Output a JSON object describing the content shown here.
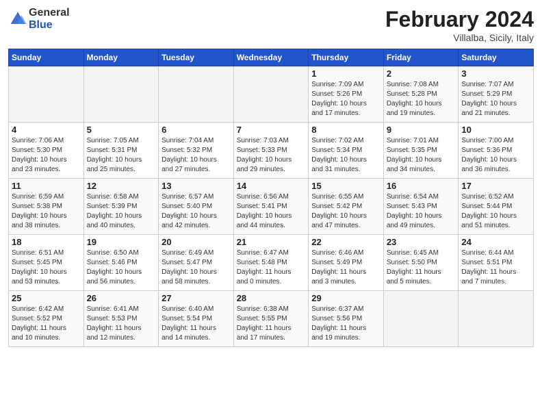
{
  "logo": {
    "general": "General",
    "blue": "Blue"
  },
  "header": {
    "month": "February 2024",
    "location": "Villalba, Sicily, Italy"
  },
  "days_of_week": [
    "Sunday",
    "Monday",
    "Tuesday",
    "Wednesday",
    "Thursday",
    "Friday",
    "Saturday"
  ],
  "weeks": [
    [
      {
        "day": "",
        "info": ""
      },
      {
        "day": "",
        "info": ""
      },
      {
        "day": "",
        "info": ""
      },
      {
        "day": "",
        "info": ""
      },
      {
        "day": "1",
        "info": "Sunrise: 7:09 AM\nSunset: 5:26 PM\nDaylight: 10 hours\nand 17 minutes."
      },
      {
        "day": "2",
        "info": "Sunrise: 7:08 AM\nSunset: 5:28 PM\nDaylight: 10 hours\nand 19 minutes."
      },
      {
        "day": "3",
        "info": "Sunrise: 7:07 AM\nSunset: 5:29 PM\nDaylight: 10 hours\nand 21 minutes."
      }
    ],
    [
      {
        "day": "4",
        "info": "Sunrise: 7:06 AM\nSunset: 5:30 PM\nDaylight: 10 hours\nand 23 minutes."
      },
      {
        "day": "5",
        "info": "Sunrise: 7:05 AM\nSunset: 5:31 PM\nDaylight: 10 hours\nand 25 minutes."
      },
      {
        "day": "6",
        "info": "Sunrise: 7:04 AM\nSunset: 5:32 PM\nDaylight: 10 hours\nand 27 minutes."
      },
      {
        "day": "7",
        "info": "Sunrise: 7:03 AM\nSunset: 5:33 PM\nDaylight: 10 hours\nand 29 minutes."
      },
      {
        "day": "8",
        "info": "Sunrise: 7:02 AM\nSunset: 5:34 PM\nDaylight: 10 hours\nand 31 minutes."
      },
      {
        "day": "9",
        "info": "Sunrise: 7:01 AM\nSunset: 5:35 PM\nDaylight: 10 hours\nand 34 minutes."
      },
      {
        "day": "10",
        "info": "Sunrise: 7:00 AM\nSunset: 5:36 PM\nDaylight: 10 hours\nand 36 minutes."
      }
    ],
    [
      {
        "day": "11",
        "info": "Sunrise: 6:59 AM\nSunset: 5:38 PM\nDaylight: 10 hours\nand 38 minutes."
      },
      {
        "day": "12",
        "info": "Sunrise: 6:58 AM\nSunset: 5:39 PM\nDaylight: 10 hours\nand 40 minutes."
      },
      {
        "day": "13",
        "info": "Sunrise: 6:57 AM\nSunset: 5:40 PM\nDaylight: 10 hours\nand 42 minutes."
      },
      {
        "day": "14",
        "info": "Sunrise: 6:56 AM\nSunset: 5:41 PM\nDaylight: 10 hours\nand 44 minutes."
      },
      {
        "day": "15",
        "info": "Sunrise: 6:55 AM\nSunset: 5:42 PM\nDaylight: 10 hours\nand 47 minutes."
      },
      {
        "day": "16",
        "info": "Sunrise: 6:54 AM\nSunset: 5:43 PM\nDaylight: 10 hours\nand 49 minutes."
      },
      {
        "day": "17",
        "info": "Sunrise: 6:52 AM\nSunset: 5:44 PM\nDaylight: 10 hours\nand 51 minutes."
      }
    ],
    [
      {
        "day": "18",
        "info": "Sunrise: 6:51 AM\nSunset: 5:45 PM\nDaylight: 10 hours\nand 53 minutes."
      },
      {
        "day": "19",
        "info": "Sunrise: 6:50 AM\nSunset: 5:46 PM\nDaylight: 10 hours\nand 56 minutes."
      },
      {
        "day": "20",
        "info": "Sunrise: 6:49 AM\nSunset: 5:47 PM\nDaylight: 10 hours\nand 58 minutes."
      },
      {
        "day": "21",
        "info": "Sunrise: 6:47 AM\nSunset: 5:48 PM\nDaylight: 11 hours\nand 0 minutes."
      },
      {
        "day": "22",
        "info": "Sunrise: 6:46 AM\nSunset: 5:49 PM\nDaylight: 11 hours\nand 3 minutes."
      },
      {
        "day": "23",
        "info": "Sunrise: 6:45 AM\nSunset: 5:50 PM\nDaylight: 11 hours\nand 5 minutes."
      },
      {
        "day": "24",
        "info": "Sunrise: 6:44 AM\nSunset: 5:51 PM\nDaylight: 11 hours\nand 7 minutes."
      }
    ],
    [
      {
        "day": "25",
        "info": "Sunrise: 6:42 AM\nSunset: 5:52 PM\nDaylight: 11 hours\nand 10 minutes."
      },
      {
        "day": "26",
        "info": "Sunrise: 6:41 AM\nSunset: 5:53 PM\nDaylight: 11 hours\nand 12 minutes."
      },
      {
        "day": "27",
        "info": "Sunrise: 6:40 AM\nSunset: 5:54 PM\nDaylight: 11 hours\nand 14 minutes."
      },
      {
        "day": "28",
        "info": "Sunrise: 6:38 AM\nSunset: 5:55 PM\nDaylight: 11 hours\nand 17 minutes."
      },
      {
        "day": "29",
        "info": "Sunrise: 6:37 AM\nSunset: 5:56 PM\nDaylight: 11 hours\nand 19 minutes."
      },
      {
        "day": "",
        "info": ""
      },
      {
        "day": "",
        "info": ""
      }
    ]
  ]
}
